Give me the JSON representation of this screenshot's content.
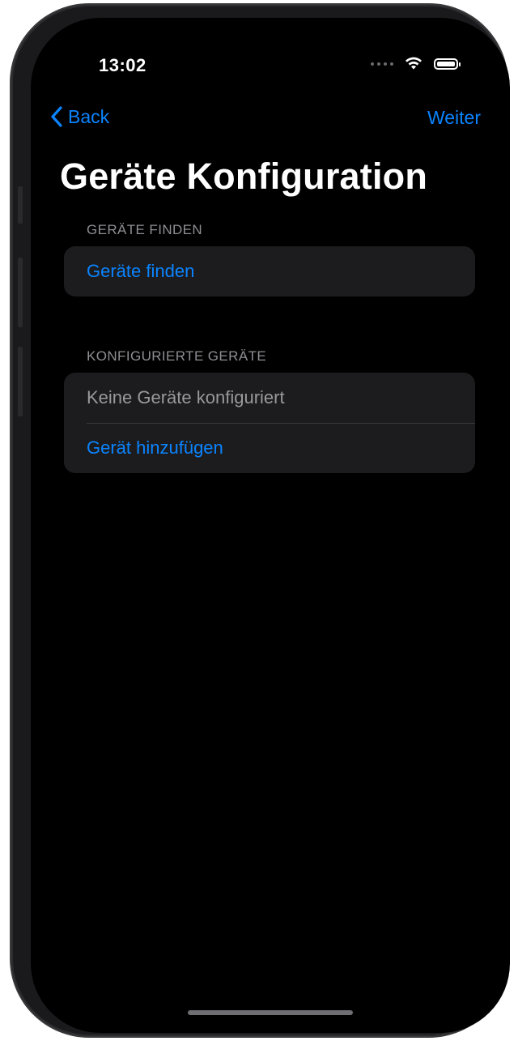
{
  "status_bar": {
    "time": "13:02",
    "icons": [
      "signal-dots-icon",
      "wifi-icon",
      "battery-icon"
    ]
  },
  "nav": {
    "back_label": "Back",
    "next_label": "Weiter",
    "title": "Geräte Konfiguration"
  },
  "sections": [
    {
      "header": "GERÄTE FINDEN",
      "rows": [
        {
          "label": "Geräte finden"
        }
      ]
    },
    {
      "header": "KONFIGURIERTE GERÄTE",
      "rows": [
        {
          "label": "Keine Geräte konfiguriert"
        },
        {
          "label": "Gerät hinzufügen"
        }
      ]
    }
  ],
  "colors": {
    "accent": "#0a84ff",
    "background": "#000000",
    "group_background": "#1c1c1e",
    "secondary_text": "#8e8e93"
  }
}
